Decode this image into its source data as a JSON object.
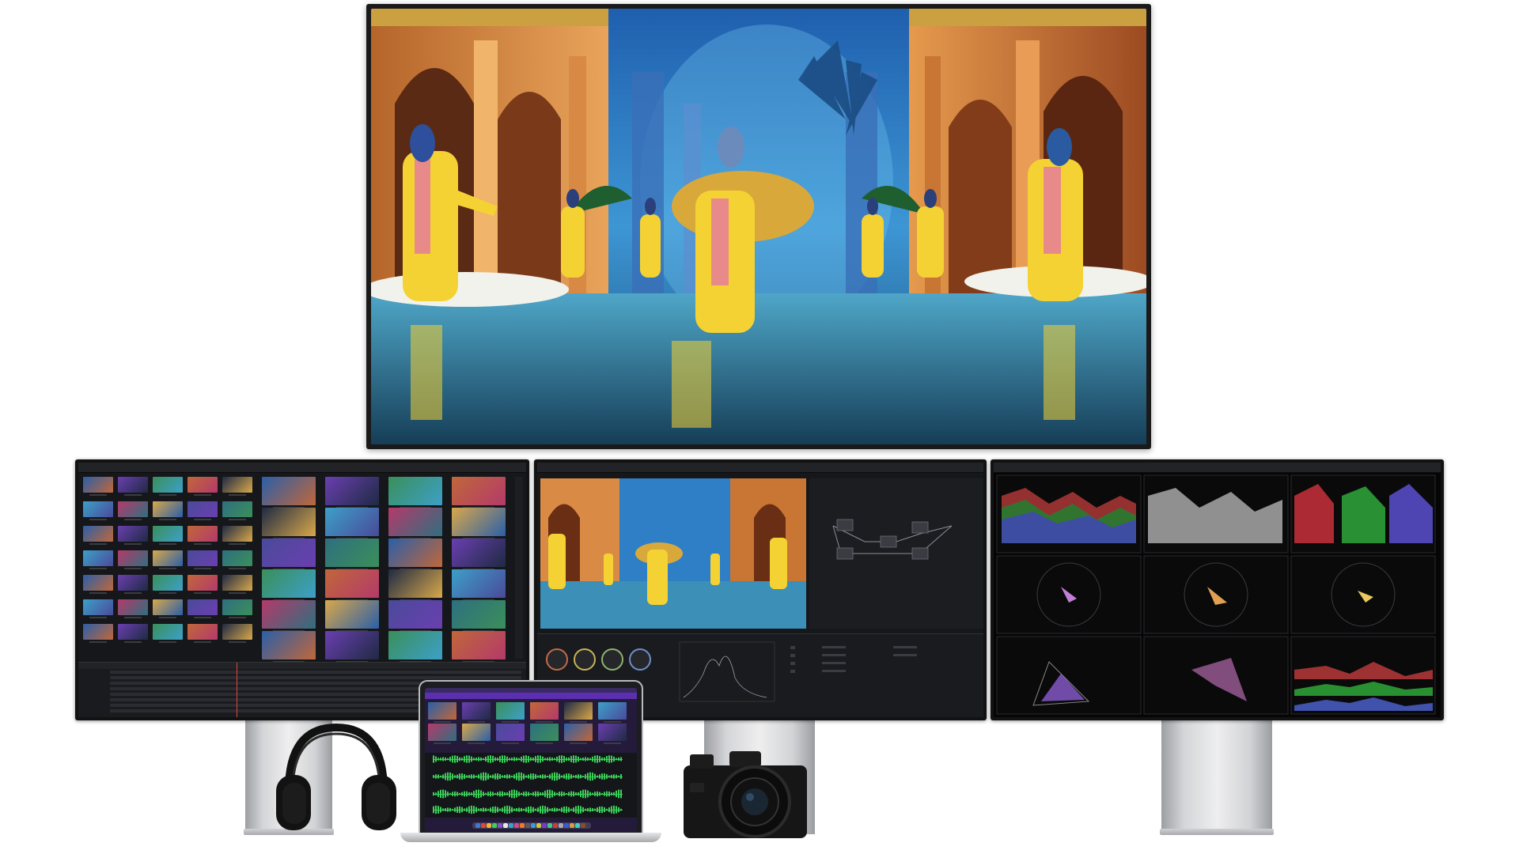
{
  "colors": {
    "background": "#ffffff",
    "ui_dark": "#16171a",
    "accent_purple": "#6a2fbf",
    "waveform_green": "#3ccf5a",
    "hero_blue": "#2f7fc6",
    "costume_yellow": "#f4d233"
  },
  "devices": {
    "reference_display": {
      "icon": "reference-monitor-icon"
    },
    "media_monitor": {
      "icon": "pro-display-icon",
      "app": "media-pool-browser"
    },
    "color_monitor": {
      "icon": "pro-display-icon",
      "app": "color-page-viewer"
    },
    "scopes_monitor": {
      "icon": "pro-display-icon",
      "app": "video-scopes"
    },
    "laptop": {
      "icon": "laptop-icon",
      "app": "fairlight-audio"
    },
    "headphones": {
      "icon": "headphones-icon"
    },
    "camera": {
      "icon": "cinema-camera-icon"
    }
  }
}
